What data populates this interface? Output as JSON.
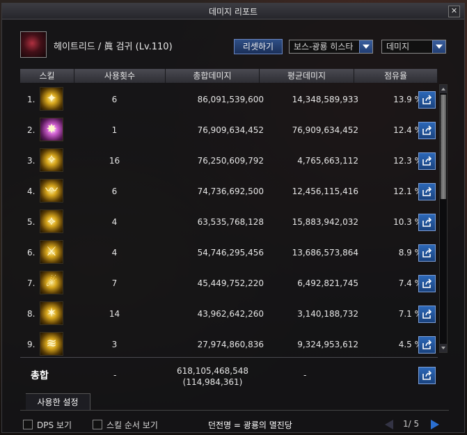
{
  "window": {
    "title": "데미지 리포트"
  },
  "character": {
    "name": "헤이트리드 / 眞 검귀 (Lv.110)"
  },
  "controls": {
    "reset_label": "리셋하기",
    "boss_filter": "보스-광룡 히스타",
    "metric_select": "데미지"
  },
  "table": {
    "headers": [
      "스킬",
      "사용횟수",
      "총합데미지",
      "평균데미지",
      "점유율"
    ],
    "rows": [
      {
        "idx": "1.",
        "count": "6",
        "total": "86,091,539,600",
        "avg": "14,348,589,933",
        "share": "13.9 %"
      },
      {
        "idx": "2.",
        "count": "1",
        "total": "76,909,634,452",
        "avg": "76,909,634,452",
        "share": "12.4 %"
      },
      {
        "idx": "3.",
        "count": "16",
        "total": "76,250,609,792",
        "avg": "4,765,663,112",
        "share": "12.3 %"
      },
      {
        "idx": "4.",
        "count": "6",
        "total": "74,736,692,500",
        "avg": "12,456,115,416",
        "share": "12.1 %"
      },
      {
        "idx": "5.",
        "count": "4",
        "total": "63,535,768,128",
        "avg": "15,883,942,032",
        "share": "10.3 %"
      },
      {
        "idx": "6.",
        "count": "4",
        "total": "54,746,295,456",
        "avg": "13,686,573,864",
        "share": "8.9 %"
      },
      {
        "idx": "7.",
        "count": "7",
        "total": "45,449,752,220",
        "avg": "6,492,821,745",
        "share": "7.4 %"
      },
      {
        "idx": "8.",
        "count": "14",
        "total": "43,962,642,260",
        "avg": "3,140,188,732",
        "share": "7.1 %"
      },
      {
        "idx": "9.",
        "count": "3",
        "total": "27,974,860,836",
        "avg": "9,324,953,612",
        "share": "4.5 %"
      }
    ]
  },
  "totals": {
    "label": "총합",
    "count": "-",
    "sum": "618,105,468,548",
    "sum_sub": "(114,984,361)",
    "avg": "-"
  },
  "tabs": {
    "used_settings": "사용한 설정"
  },
  "footer": {
    "dps_label": "DPS 보기",
    "skill_order_label": "스킬 순서 보기",
    "dungeon": "던전명 = 광룡의 멸진당",
    "page": "1/ 5"
  },
  "colors": {
    "accent_blue": "#2b6fd0",
    "gold_icon": "#d9a81d"
  }
}
